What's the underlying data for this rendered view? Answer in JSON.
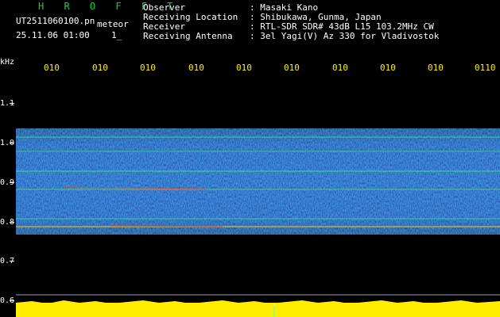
{
  "header": {
    "title": "H R O F F T",
    "filename": "UT2511060100.pn",
    "mode": "meteor",
    "datetime": "25.11.06 01:00",
    "datetime_extra": "1_",
    "fields": [
      {
        "label": "Observer",
        "value": ": Masaki Kano"
      },
      {
        "label": "Receiving Location",
        "value": ": Shibukawa, Gunma, Japan"
      },
      {
        "label": "Receiver",
        "value": ": RTL-SDR SDR# 43dB L15 103.2MHz CW"
      },
      {
        "label": "Receiving Antenna",
        "value": ": 3el Yagi(V) Az 330 for Vladivostok"
      }
    ]
  },
  "axis": {
    "unit": "kHz",
    "time_ticks": [
      "010",
      "010",
      "010",
      "010",
      "010",
      "010",
      "010",
      "010",
      "010",
      "0110"
    ],
    "freq_ticks": [
      "1.1",
      "1.0",
      "0.9",
      "0.8",
      "0.7",
      "0.6"
    ]
  },
  "colors": {
    "background": "#000000",
    "title": "#00d84a",
    "time_ticks": "#ffee00",
    "text": "#ffffff",
    "band": "#1a2fb0",
    "baseline": "#ffee00"
  }
}
